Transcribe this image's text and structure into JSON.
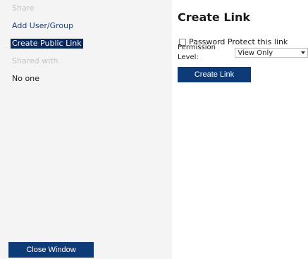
{
  "sidebar": {
    "share_heading": "Share",
    "add_user_group": "Add User/Group",
    "create_public_link": "Create Public Link",
    "shared_with_heading": "Shared with",
    "shared_with_value": "No one",
    "close_window": "Close Window"
  },
  "main": {
    "title": "Create Link",
    "password_protect_label": "Password Protect this link",
    "password_protect_checked": false,
    "permission_label": "Permission Level:",
    "permission_value": "View Only",
    "create_link_button": "Create Link"
  },
  "icons": {
    "dropdown": "chevron-down-icon"
  },
  "colors": {
    "accent": "#0d3b78",
    "selected_bg": "#0a2a5e",
    "link": "#1f3f7a",
    "sidebar_bg": "#f4f4f4"
  }
}
